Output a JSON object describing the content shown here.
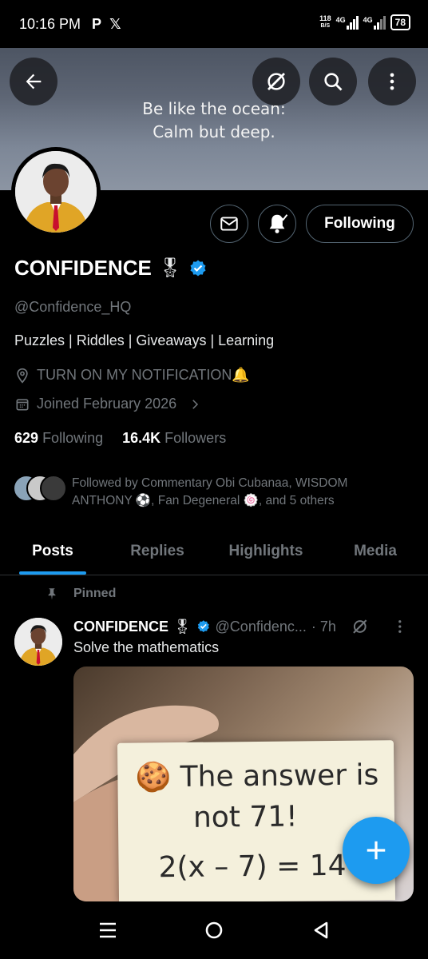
{
  "status_bar": {
    "time": "10:16 PM",
    "app_icons": [
      "P",
      "𝕏"
    ],
    "net_speed_value": "118",
    "net_speed_unit": "B/S",
    "signal1_label": "4G",
    "signal2_label": "4G",
    "battery": "78"
  },
  "banner": {
    "quote_line1": "Be like the ocean:",
    "quote_line2": "Calm but deep.",
    "background_color": "#5e6675"
  },
  "profile": {
    "display_name": "CONFIDENCE",
    "medal_icon": "🎖",
    "handle": "@Confidence_HQ",
    "bio": "Puzzles | Riddles | Giveaways | Learning",
    "location": "TURN ON MY NOTIFICATION🔔",
    "joined": "Joined February 2026",
    "following_count": "629",
    "following_label": "Following",
    "followers_count": "16.4K",
    "followers_label": "Followers",
    "followed_by": "Followed by Commentary Obi Cubanaa, WISDOM ANTHONY ⚽, Fan Degeneral 🍥, and 5 others",
    "follow_button": "Following"
  },
  "tabs": [
    "Posts",
    "Replies",
    "Highlights",
    "Media"
  ],
  "active_tab": "Posts",
  "pinned_post": {
    "pinned_label": "Pinned",
    "author": "CONFIDENCE",
    "medal_icon": "🎖",
    "handle": "@Confidenc...",
    "time": "· 7h",
    "text": "Solve the mathematics",
    "image_text_line1": "🍪 The answer is",
    "image_text_line2": "not 71!",
    "image_text_line3": "2(x – 7) = 14"
  },
  "colors": {
    "accent": "#1d9bf0",
    "verified": "#1d9bf0",
    "secondary_text": "#71767b",
    "border": "#536471",
    "avatar_jacket": "#e0a526",
    "avatar_tie": "#c8102e"
  }
}
